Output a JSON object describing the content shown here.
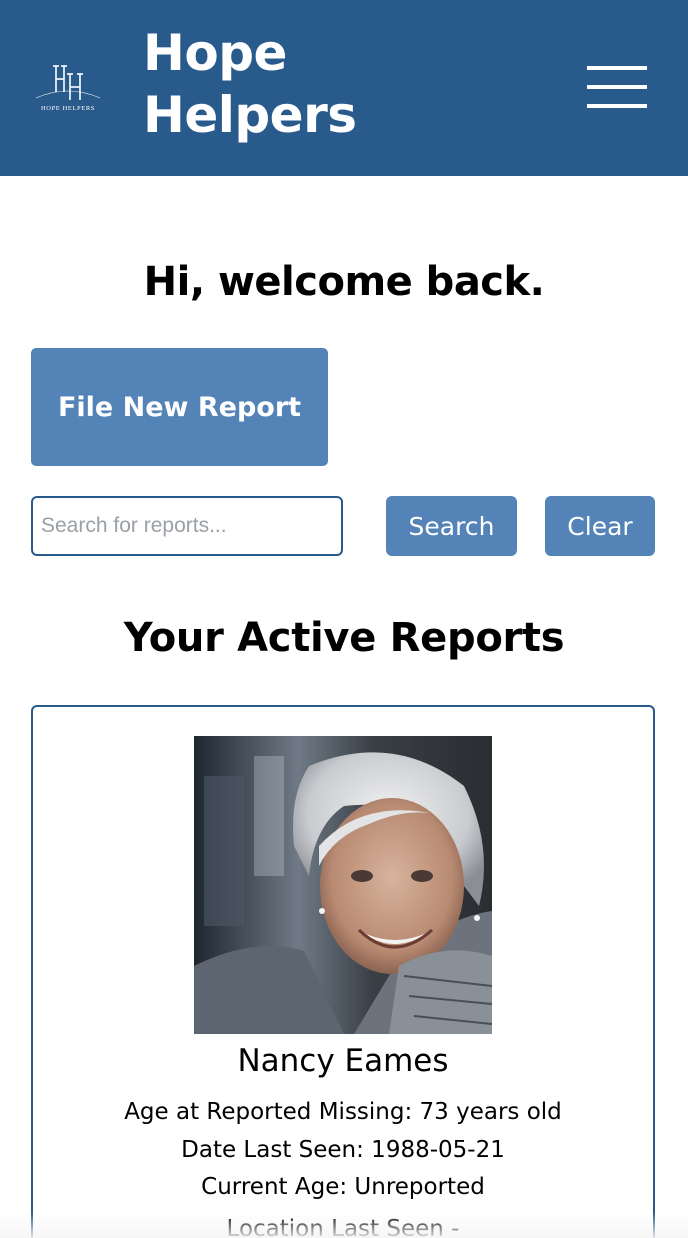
{
  "header": {
    "logo_monogram": "HH",
    "logo_text": "HOPE HELPERS",
    "title_line1": "Hope",
    "title_line2": "Helpers",
    "menu_icon": "hamburger-menu-icon",
    "background_color": "#285a8c"
  },
  "main": {
    "welcome_text": "Hi, welcome back.",
    "file_report_label": "File New Report",
    "search": {
      "placeholder": "Search for reports...",
      "value": "",
      "search_label": "Search",
      "clear_label": "Clear"
    },
    "section_title": "Your Active Reports",
    "accent_color": "#5484b7"
  },
  "reports": [
    {
      "photo_icon": "person-photo",
      "name": "Nancy Eames",
      "age_missing": "Age at Reported Missing: 73 years old",
      "date_last_seen": "Date Last Seen: 1988-05-21",
      "current_age": "Current Age: Unreported",
      "location_label": "Location Last Seen -"
    }
  ]
}
